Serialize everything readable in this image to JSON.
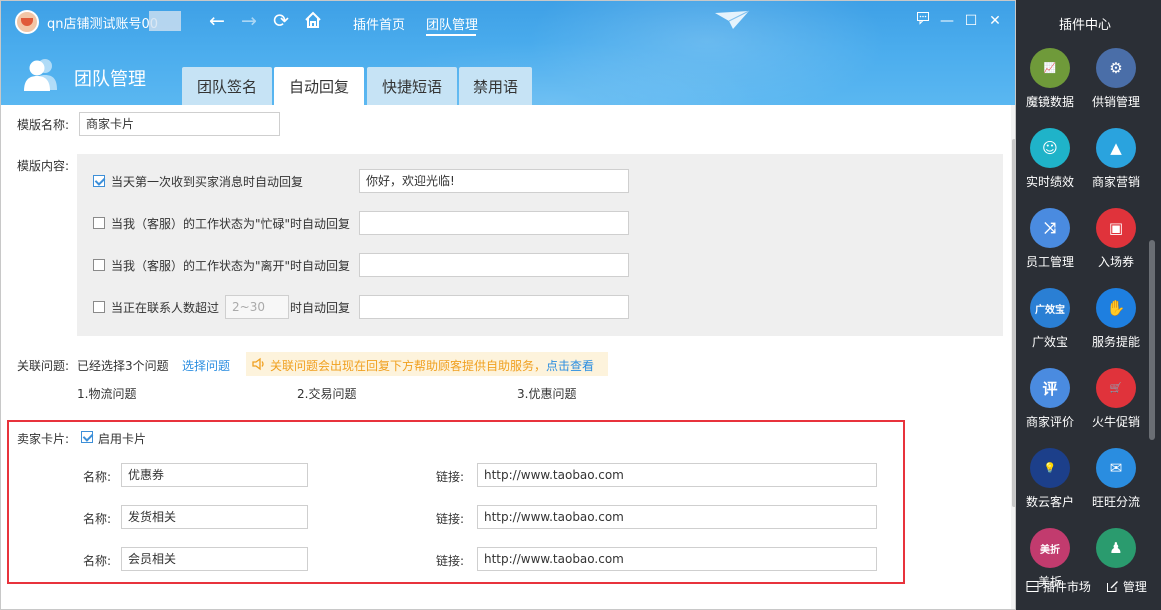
{
  "window": {
    "account_name": "qn店铺测试账号00",
    "top_tabs": [
      "插件首页",
      "团队管理"
    ],
    "title": "团队管理",
    "tabs": [
      "团队签名",
      "自动回复",
      "快捷短语",
      "禁用语"
    ],
    "active_tab": "自动回复"
  },
  "form": {
    "template_name_label": "模版名称:",
    "template_name_value": "商家卡片",
    "template_content_label": "模版内容:",
    "rules": [
      {
        "label": "当天第一次收到买家消息时自动回复",
        "checked": true,
        "reply": "你好，欢迎光临!"
      },
      {
        "label": "当我（客服）的工作状态为\"忙碌\"时自动回复",
        "checked": false,
        "reply": ""
      },
      {
        "label": "当我（客服）的工作状态为\"离开\"时自动回复",
        "checked": false,
        "reply": ""
      },
      {
        "label_before": "当正在联系人数超过",
        "placeholder": "2~30",
        "label_after": "时自动回复",
        "checked": false,
        "reply": ""
      }
    ],
    "related": {
      "label": "关联问题:",
      "status": "已经选择3个问题",
      "select_link": "选择问题",
      "tip": "关联问题会出现在回复下方帮助顾客提供自助服务，",
      "tip_link": "点击查看",
      "questions": [
        "1.物流问题",
        "2.交易问题",
        "3.优惠问题"
      ]
    },
    "seller_card": {
      "label": "卖家卡片:",
      "enable_label": "启用卡片",
      "enabled": true,
      "name_label": "名称:",
      "link_label": "链接:",
      "cards": [
        {
          "name": "优惠券",
          "link": "http://www.taobao.com"
        },
        {
          "name": "发货相关",
          "link": "http://www.taobao.com"
        },
        {
          "name": "会员相关",
          "link": "http://www.taobao.com"
        }
      ]
    }
  },
  "plugin_center": {
    "title": "插件中心",
    "plugins": [
      {
        "name": "魔镜数据",
        "icon": "chart-icon",
        "color": "#6f9a3a",
        "glyph": "📈"
      },
      {
        "name": "供销管理",
        "icon": "supply-icon",
        "color": "#4a6ea8",
        "glyph": "⚙"
      },
      {
        "name": "实时绩效",
        "icon": "performance-icon",
        "color": "#1fb3c9",
        "glyph": "☺"
      },
      {
        "name": "商家营销",
        "icon": "marketing-icon",
        "color": "#2aa3de",
        "glyph": "▲"
      },
      {
        "name": "员工管理",
        "icon": "staff-icon",
        "color": "#4a8be0",
        "glyph": "⤨"
      },
      {
        "name": "入场券",
        "icon": "ticket-icon",
        "color": "#e0333b",
        "glyph": "▣"
      },
      {
        "name": "广效宝",
        "icon": "ad-icon",
        "color": "#2a7fd4",
        "glyph": "广效宝"
      },
      {
        "name": "服务提能",
        "icon": "service-icon",
        "color": "#1e7fe0",
        "glyph": "✋"
      },
      {
        "name": "商家评价",
        "icon": "review-icon",
        "color": "#4a8be0",
        "glyph": "评"
      },
      {
        "name": "火牛促销",
        "icon": "promo-icon",
        "color": "#e0333b",
        "glyph": "🛒"
      },
      {
        "name": "数云客户",
        "icon": "customer-icon",
        "color": "#1c3f8a",
        "glyph": "💡"
      },
      {
        "name": "旺旺分流",
        "icon": "shunt-icon",
        "color": "#2a8de0",
        "glyph": "✉"
      },
      {
        "name": "美折",
        "icon": "discount-icon",
        "color": "#c23b6e",
        "glyph": "美折"
      },
      {
        "name": "",
        "icon": "plugin-icon",
        "color": "#2a9b6e",
        "glyph": "♟"
      }
    ],
    "footer": {
      "market": "插件市场",
      "manage": "管理"
    }
  }
}
